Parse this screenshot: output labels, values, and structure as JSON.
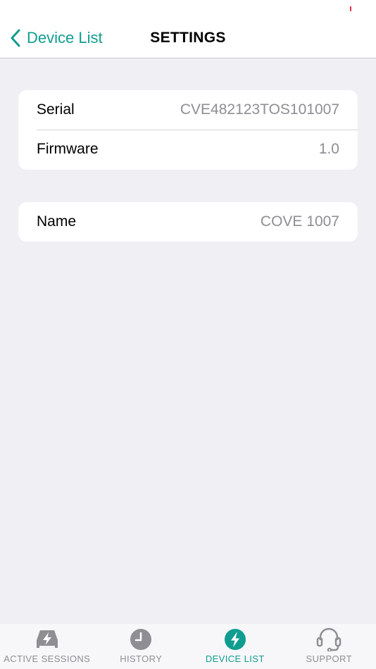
{
  "nav": {
    "back_label": "Device List",
    "title": "SETTINGS"
  },
  "device_info": [
    {
      "label": "Serial",
      "value": "CVE482123TOS101007"
    },
    {
      "label": "Firmware",
      "value": "1.0"
    }
  ],
  "device_name": {
    "label": "Name",
    "value": "COVE 1007"
  },
  "tabs": [
    {
      "label": "ACTIVE SESSIONS",
      "icon": "car-charging-icon",
      "active": false
    },
    {
      "label": "HISTORY",
      "icon": "clock-icon",
      "active": false
    },
    {
      "label": "DEVICE LIST",
      "icon": "lightning-icon",
      "active": true
    },
    {
      "label": "SUPPORT",
      "icon": "headset-icon",
      "active": false
    }
  ],
  "colors": {
    "accent": "#109d90",
    "inactive": "#8e8e93",
    "background": "#efeff4",
    "card": "#ffffff"
  }
}
